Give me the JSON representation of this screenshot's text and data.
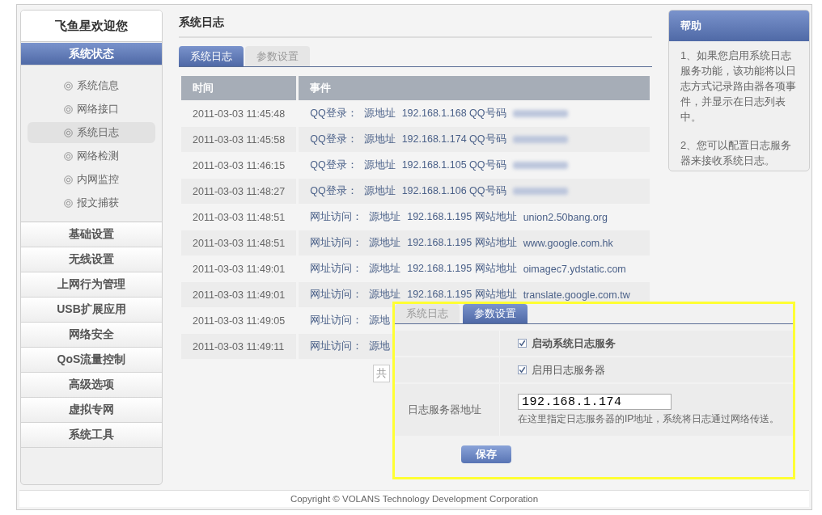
{
  "sidebar": {
    "welcome": "飞鱼星欢迎您",
    "sections": [
      {
        "label": "系统状态",
        "expanded": true,
        "children": [
          {
            "label": "系统信息",
            "selected": false
          },
          {
            "label": "网络接口",
            "selected": false
          },
          {
            "label": "系统日志",
            "selected": true
          },
          {
            "label": "网络检测",
            "selected": false
          },
          {
            "label": "内网监控",
            "selected": false
          },
          {
            "label": "报文捕获",
            "selected": false
          }
        ]
      },
      {
        "label": "基础设置",
        "expanded": false
      },
      {
        "label": "无线设置",
        "expanded": false
      },
      {
        "label": "上网行为管理",
        "expanded": false
      },
      {
        "label": "USB扩展应用",
        "expanded": false
      },
      {
        "label": "网络安全",
        "expanded": false
      },
      {
        "label": "QoS流量控制",
        "expanded": false
      },
      {
        "label": "高级选项",
        "expanded": false
      },
      {
        "label": "虚拟专网",
        "expanded": false
      },
      {
        "label": "系统工具",
        "expanded": false
      }
    ]
  },
  "page_title": "系统日志",
  "tabs": [
    {
      "label": "系统日志",
      "selected": true
    },
    {
      "label": "参数设置",
      "selected": false
    }
  ],
  "table": {
    "columns": [
      "时间",
      "事件"
    ],
    "rows": [
      {
        "time": "2011-03-03 11:45:48",
        "type": "QQ登录：",
        "source_label": "源地址",
        "detail": "192.168.1.168 QQ号码",
        "redacted": true
      },
      {
        "time": "2011-03-03 11:45:58",
        "type": "QQ登录：",
        "source_label": "源地址",
        "detail": "192.168.1.174 QQ号码",
        "redacted": true
      },
      {
        "time": "2011-03-03 11:46:15",
        "type": "QQ登录：",
        "source_label": "源地址",
        "detail": "192.168.1.105 QQ号码",
        "redacted": true
      },
      {
        "time": "2011-03-03 11:48:27",
        "type": "QQ登录：",
        "source_label": "源地址",
        "detail": "192.168.1.106 QQ号码",
        "redacted": true
      },
      {
        "time": "2011-03-03 11:48:51",
        "type": "网址访问：",
        "source_label": "源地址",
        "detail": "192.168.1.195 网站地址",
        "site": "union2.50bang.org",
        "redacted": false
      },
      {
        "time": "2011-03-03 11:48:51",
        "type": "网址访问：",
        "source_label": "源地址",
        "detail": "192.168.1.195 网站地址",
        "site": "www.google.com.hk",
        "redacted": false
      },
      {
        "time": "2011-03-03 11:49:01",
        "type": "网址访问：",
        "source_label": "源地址",
        "detail": "192.168.1.195 网站地址",
        "site": "oimagec7.ydstatic.com",
        "redacted": false
      },
      {
        "time": "2011-03-03 11:49:01",
        "type": "网址访问：",
        "source_label": "源地址",
        "detail": "192.168.1.195 网站地址",
        "site": "translate.google.com.tw",
        "redacted": false
      },
      {
        "time": "2011-03-03 11:49:05",
        "type": "网址访问：",
        "source_label": "源地",
        "redacted": false
      },
      {
        "time": "2011-03-03 11:49:11",
        "type": "网址访问：",
        "source_label": "源地",
        "redacted": false
      }
    ]
  },
  "pager": {
    "text": "共"
  },
  "help": {
    "title": "帮助",
    "paragraphs": [
      "1、如果您启用系统日志服务功能，该功能将以日志方式记录路由器各项事件，并显示在日志列表中。",
      "2、您可以配置日志服务器来接收系统日志。"
    ]
  },
  "footer": "Copyright © VOLANS Technology Development Corporation",
  "overlay": {
    "tabs": [
      {
        "label": "系统日志",
        "selected": false
      },
      {
        "label": "参数设置",
        "selected": true
      }
    ],
    "checkboxes": [
      {
        "label": "启动系统日志服务",
        "checked": true,
        "bold": true
      },
      {
        "label": "启用日志服务器",
        "checked": true,
        "bold": false
      }
    ],
    "server": {
      "label": "日志服务器地址",
      "value": "192.168.1.174",
      "hint": "在这里指定日志服务器的IP地址，系统将日志通过网络传送。"
    },
    "save_button": "保存"
  }
}
